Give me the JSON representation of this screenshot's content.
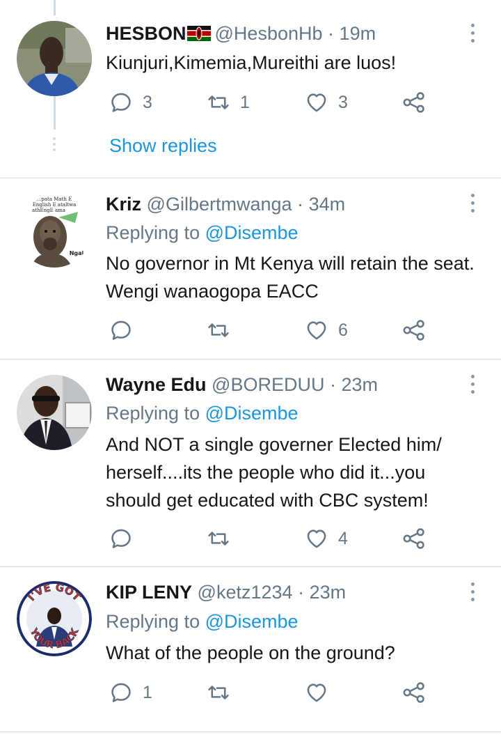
{
  "tweets": [
    {
      "name": "HESBON",
      "handle": "@HesbonHb",
      "sep": "·",
      "time": "19m",
      "reply_prefix": "",
      "reply_mention": "",
      "text": "Kiunjuri,Kimemia,Mureithi are luos!",
      "reply_count": "3",
      "retweet_count": "1",
      "like_count": "3"
    },
    {
      "name": "Kriz",
      "handle": "@Gilbertmwanga",
      "sep": "·",
      "time": "34m",
      "reply_prefix": "Replying to ",
      "reply_mention": "@Disembe",
      "text": "No governor in Mt Kenya will retain the seat. Wengi wanaogopa EACC",
      "reply_count": "",
      "retweet_count": "",
      "like_count": "6"
    },
    {
      "name": "Wayne Edu",
      "handle": "@BOREDUU",
      "sep": "·",
      "time": "23m",
      "reply_prefix": "Replying to ",
      "reply_mention": "@Disembe",
      "text": "And NOT a single governer Elected him/ herself....its the people who did it...you should get  educated with CBC system!",
      "reply_count": "",
      "retweet_count": "",
      "like_count": "4"
    },
    {
      "name": "KIP LENY",
      "handle": "@ketz1234",
      "sep": "·",
      "time": "23m",
      "reply_prefix": "Replying to ",
      "reply_mention": "@Disembe",
      "text": "What of the people on the ground?",
      "reply_count": "1",
      "retweet_count": "",
      "like_count": ""
    }
  ],
  "show_replies": "Show replies",
  "avatar_kriz_caption": {
    "line1": "...pata Math E",
    "line2": "English E ataltwa",
    "line3": "athEngE ama",
    "tag": "Ngai"
  },
  "avatar_kip_badge": {
    "top": "I'VE GOT",
    "bottom": "YOUR BACK"
  },
  "icons": [
    "reply-icon",
    "retweet-icon",
    "like-icon",
    "share-icon",
    "more-icon",
    "kenya-flag-icon"
  ],
  "colors": {
    "link": "#1b95e0",
    "secondary_text": "#657786",
    "icon": "#657786",
    "thread_line": "#cfd9de"
  }
}
